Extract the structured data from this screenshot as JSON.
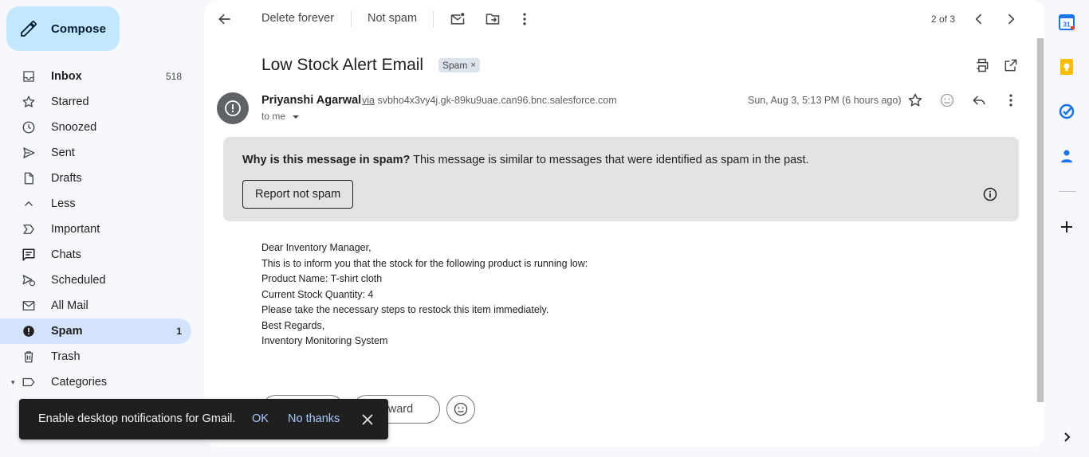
{
  "compose": {
    "label": "Compose"
  },
  "sidebar": {
    "items": [
      {
        "label": "Inbox",
        "count": "518",
        "icon": "inbox-icon"
      },
      {
        "label": "Starred",
        "count": "",
        "icon": "star-icon"
      },
      {
        "label": "Snoozed",
        "count": "",
        "icon": "clock-icon"
      },
      {
        "label": "Sent",
        "count": "",
        "icon": "send-icon"
      },
      {
        "label": "Drafts",
        "count": "",
        "icon": "draft-icon"
      },
      {
        "label": "Less",
        "count": "",
        "icon": "chevron-up-icon"
      },
      {
        "label": "Important",
        "count": "",
        "icon": "important-icon"
      },
      {
        "label": "Chats",
        "count": "",
        "icon": "chat-icon"
      },
      {
        "label": "Scheduled",
        "count": "",
        "icon": "scheduled-icon"
      },
      {
        "label": "All Mail",
        "count": "",
        "icon": "all-mail-icon"
      },
      {
        "label": "Spam",
        "count": "1",
        "icon": "spam-icon"
      },
      {
        "label": "Trash",
        "count": "",
        "icon": "trash-icon"
      },
      {
        "label": "Categories",
        "count": "",
        "icon": "label-icon"
      }
    ]
  },
  "toolbar": {
    "delete_forever": "Delete forever",
    "not_spam": "Not spam",
    "pager": "2 of 3"
  },
  "email": {
    "subject": "Low Stock Alert Email",
    "label_chip": "Spam",
    "label_chip_close": "×",
    "sender_name": "Priyanshi Agarwal",
    "via_word": "via",
    "via_domain": "svbho4x3vy4j.gk-89ku9uae.can96.bnc.salesforce.com",
    "to": "to me",
    "date": "Sun, Aug 3, 5:13 PM (6 hours ago)",
    "body_lines": [
      "Dear Inventory Manager,",
      "This is to inform you that the stock for the following product is running low:",
      "Product Name: T-shirt cloth",
      "Current Stock Quantity: 4",
      "Please take the necessary steps to restock this item immediately.",
      "Best Regards,",
      "Inventory Monitoring System"
    ]
  },
  "spam_notice": {
    "question": "Why is this message in spam?",
    "explanation": " This message is similar to messages that were identified as spam in the past.",
    "report_button": "Report not spam"
  },
  "actions": {
    "forward": "Forward"
  },
  "snackbar": {
    "message": "Enable desktop notifications for Gmail.",
    "ok": "OK",
    "no_thanks": "No thanks"
  },
  "colors": {
    "compose_bg": "#c2e7ff",
    "active_nav_bg": "#d3e3fd",
    "spam_box_bg": "#e3e3e3",
    "snackbar_bg": "#1f1f1f",
    "snackbar_link": "#a8c7fa"
  }
}
